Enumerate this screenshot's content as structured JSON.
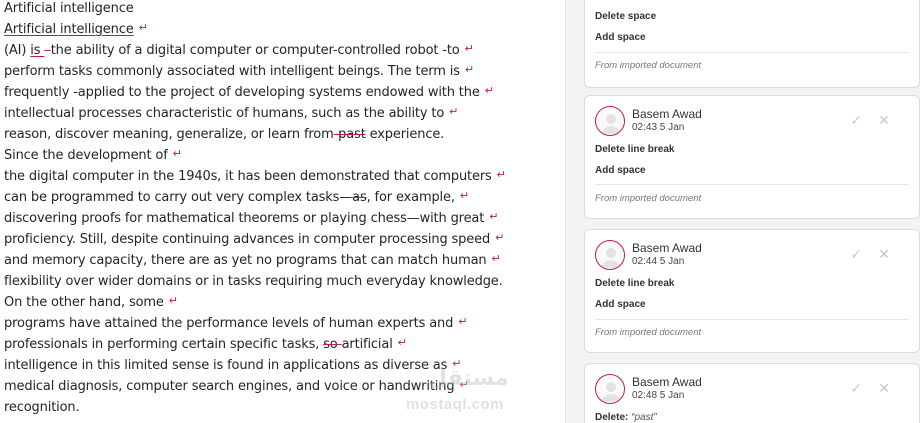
{
  "document": {
    "lines": [
      "Artificial intelligence",
      "Artificial intelligence",
      "(AI) is –the ability of a digital computer or computer-controlled robot -to",
      "perform tasks commonly associated with intelligent beings. The term is",
      "frequently -applied to the project of developing systems endowed with the",
      "intellectual processes characteristic of humans, such as the ability to",
      "reason, discover meaning, generalize, or learn from-past experience.",
      "Since the development of",
      "the digital computer in the 1940s, it has been demonstrated that computers",
      "can be programmed to carry out very complex tasks—as, for example,",
      "discovering proofs for mathematical theorems or playing chess—with great",
      "proficiency. Still, despite continuing advances in computer processing speed",
      "and memory capacity, there are as yet no programs that can match human",
      "flexibility over wider domains or in tasks requiring much everyday knowledge.",
      "On the other hand, some",
      "programs have attained the performance levels of human experts and",
      "professionals in performing certain specific tasks,  so artificial",
      "intelligence in this limited sense is found in applications as diverse as",
      "medical diagnosis, computer search engines, and voice or handwriting",
      "recognition."
    ],
    "segments": {
      "l2_a": "Artificial intelligence",
      "l3_ins": "is ",
      "l3_del": "–",
      "l3_rest": "the ability of a digital computer or computer-controlled robot -to",
      "l7_a": "reason, discover meaning, generalize, or learn from",
      "l7_del": "-past",
      "l7_b": " experience.",
      "l10_a": "can be programmed to carry out very complex tasks—",
      "l10_del": "as",
      "l10_b": ", for example,",
      "l17_a": "professionals in performing certain specific tasks,  ",
      "l17_del": "so ",
      "l17_b": "artificial"
    },
    "paragraph_mark": "↵"
  },
  "review": {
    "cards": [
      {
        "actions": [
          "Delete space",
          "Add space"
        ],
        "source": "From imported document"
      },
      {
        "author": "Basem Awad",
        "time": "02:43 5 Jan",
        "actions": [
          "Delete line break",
          "Add space"
        ],
        "source": "From imported document"
      },
      {
        "author": "Basem Awad",
        "time": "02:44 5 Jan",
        "actions": [
          "Delete line break",
          "Add space"
        ],
        "source": "From imported document"
      },
      {
        "author": "Basem Awad",
        "time": "02:48 5 Jan",
        "action_label": "Delete:",
        "action_quote": "“past”"
      }
    ],
    "accept_icon": "check-icon",
    "reject_icon": "close-icon",
    "accent": "#c2185b"
  },
  "watermark": {
    "arabic": "مستقل",
    "latin": "mostaql.com"
  }
}
